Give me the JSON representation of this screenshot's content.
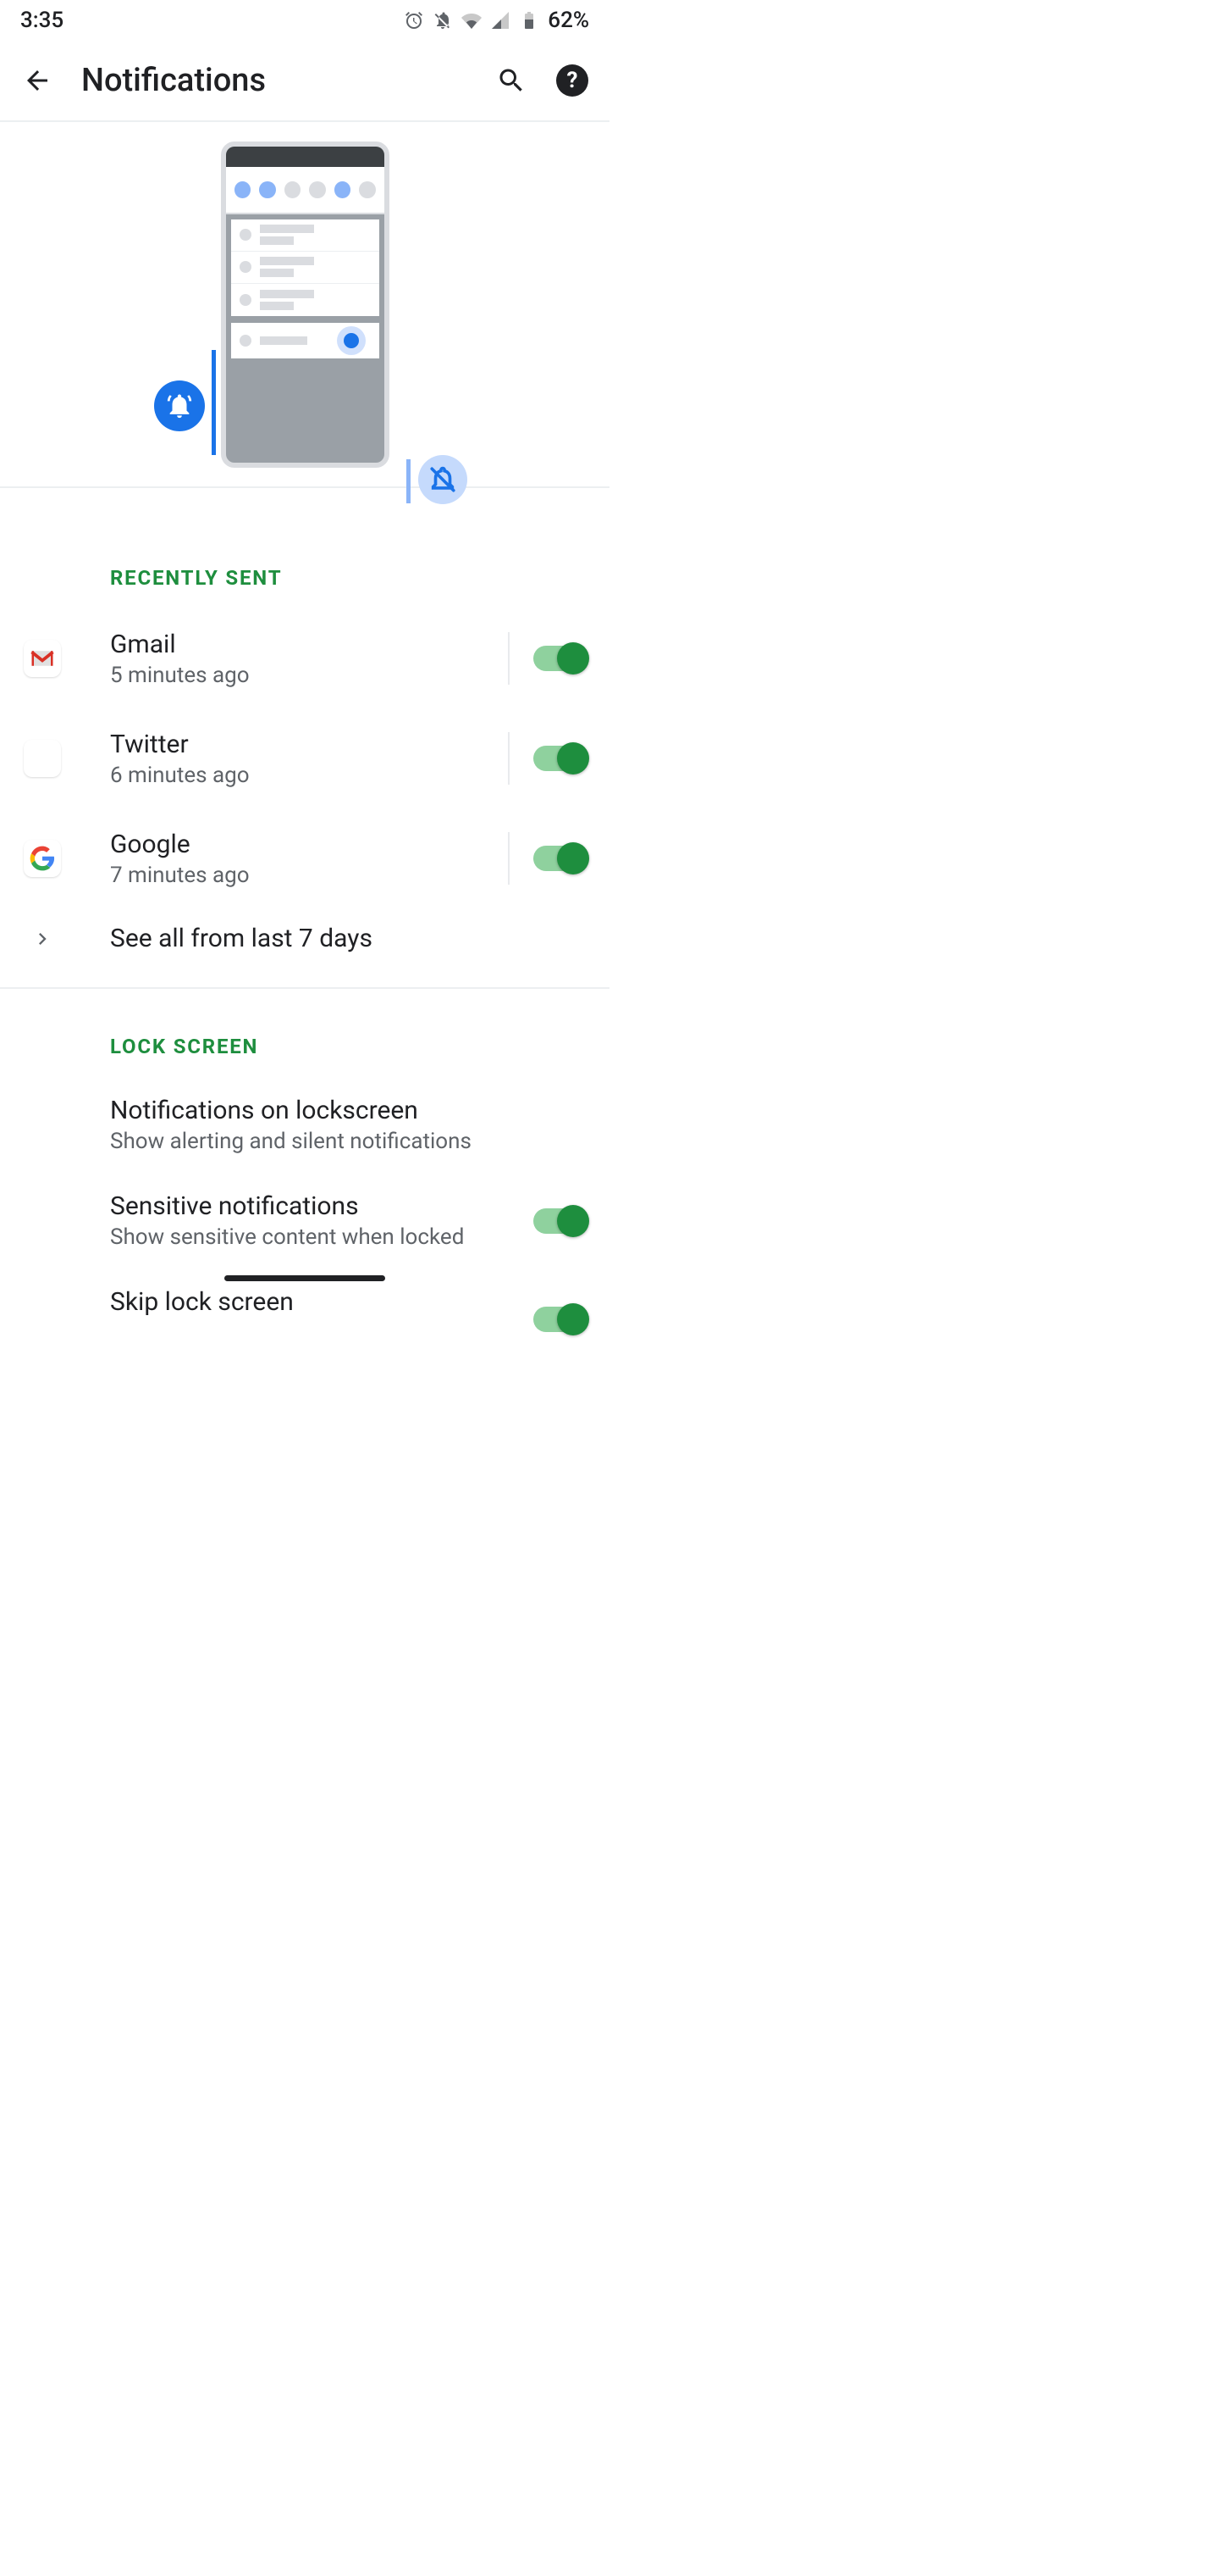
{
  "status": {
    "time": "3:35",
    "battery": "62%"
  },
  "appbar": {
    "title": "Notifications"
  },
  "sections": {
    "recent_header": "Recently sent",
    "lock_header": "Lock screen"
  },
  "recent": [
    {
      "name": "Gmail",
      "sub": "5 minutes ago",
      "icon": "gmail",
      "enabled": true
    },
    {
      "name": "Twitter",
      "sub": "6 minutes ago",
      "icon": "twitter",
      "enabled": true
    },
    {
      "name": "Google",
      "sub": "7 minutes ago",
      "icon": "google",
      "enabled": true
    }
  ],
  "see_all": "See all from last 7 days",
  "lock": {
    "notifs_title": "Notifications on lockscreen",
    "notifs_desc": "Show alerting and silent notifications",
    "sensitive_title": "Sensitive notifications",
    "sensitive_desc": "Show sensitive content when locked",
    "skip_title": "Skip lock screen"
  }
}
